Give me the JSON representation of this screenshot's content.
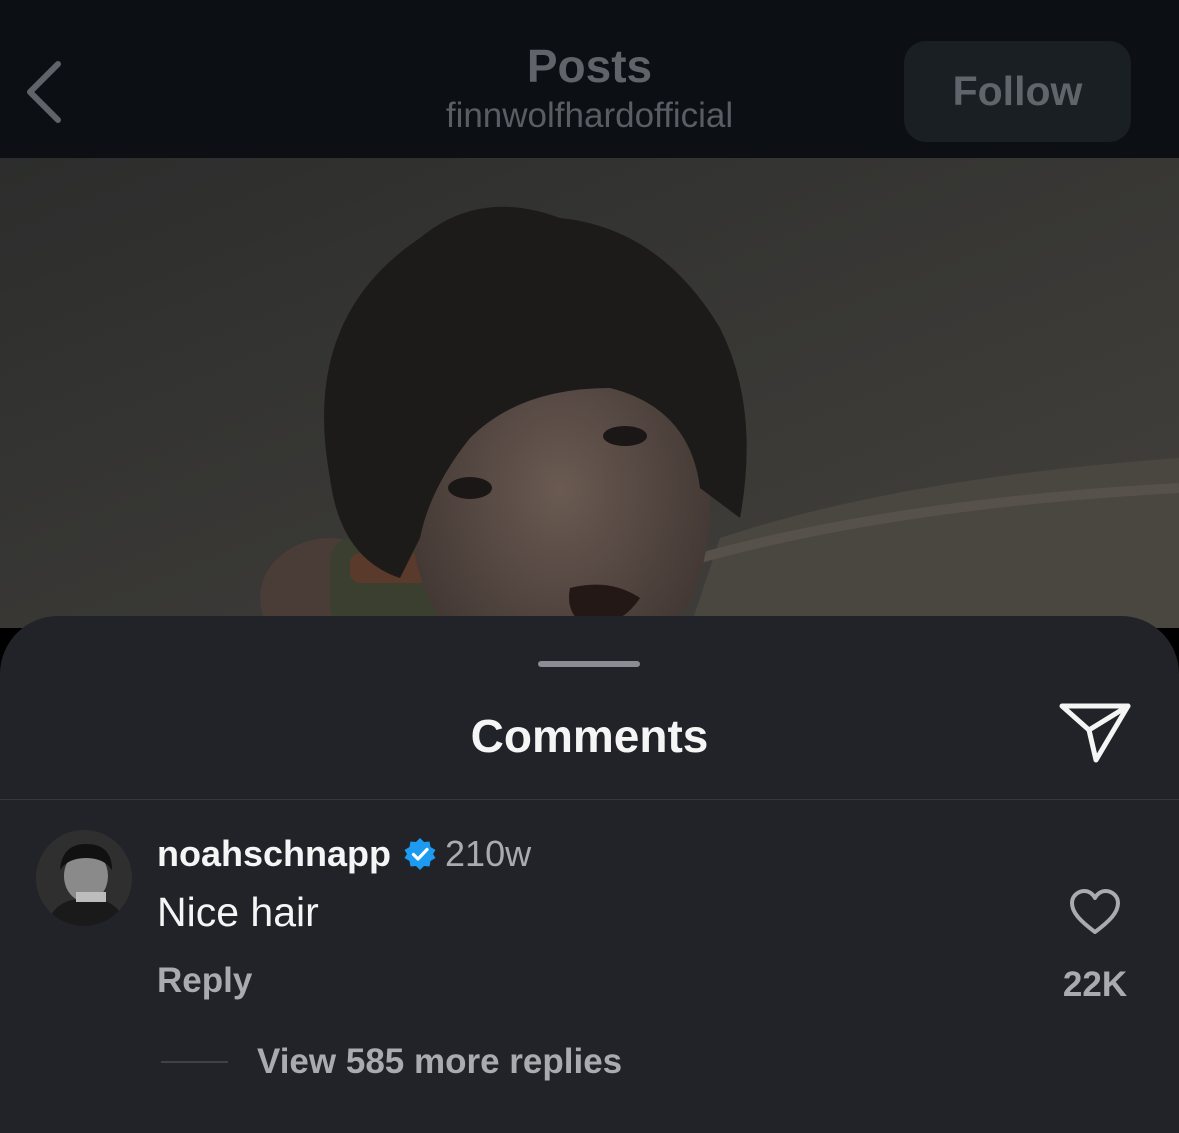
{
  "header": {
    "title": "Posts",
    "username": "finnwolfhardofficial",
    "follow_label": "Follow",
    "back_icon": "chevron-left-icon"
  },
  "post": {
    "image_description_icon": "post-photo"
  },
  "comments_sheet": {
    "title": "Comments",
    "share_icon": "paper-plane-icon",
    "comment": {
      "username": "noahschnapp",
      "verified": true,
      "time": "210w",
      "text": "Nice hair",
      "reply_label": "Reply",
      "like_icon": "heart-icon",
      "like_count": "22K",
      "view_replies": "View 585 more replies"
    }
  },
  "colors": {
    "top_bar": "#0c1014",
    "sheet_bg": "#212328",
    "verified_blue": "#1d9bf0",
    "secondary_text": "#a9abb0"
  }
}
